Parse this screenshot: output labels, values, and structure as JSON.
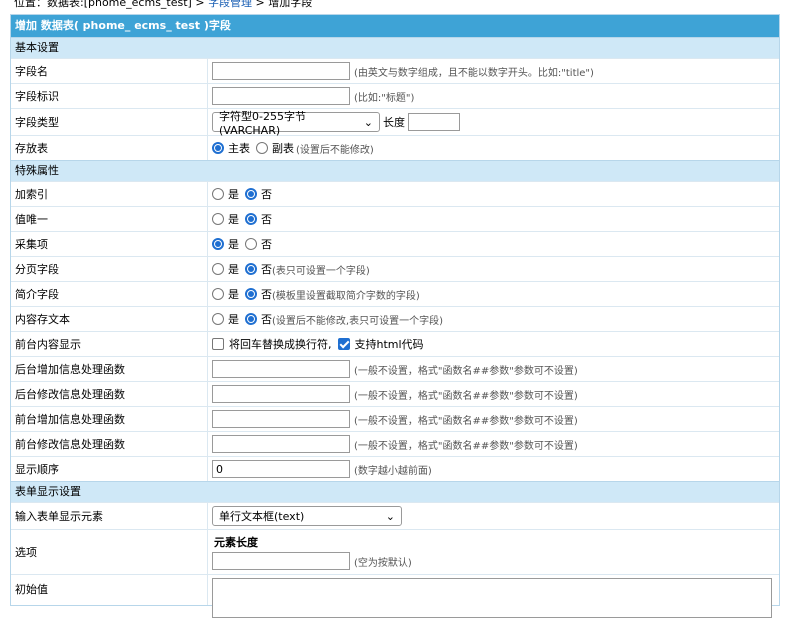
{
  "breadcrumb": {
    "prefix": "位置：",
    "table_text": "数据表:[phome_ecms_test]",
    "sep1": " > ",
    "link": "字段管理",
    "sep2": " > ",
    "current": "增加字段"
  },
  "panel_title": "增加 数据表( phome_ ecms_ test )字段",
  "basic": {
    "section": "基本设置",
    "field_name": {
      "label": "字段名",
      "value": "",
      "hint": "(由英文与数字组成，且不能以数字开头。比如:\"title\")"
    },
    "field_mark": {
      "label": "字段标识",
      "value": "",
      "hint": "(比如:\"标题\")"
    },
    "field_type": {
      "label": "字段类型",
      "selected": "字符型0-255字节(VARCHAR)",
      "length_label": "长度",
      "length_value": ""
    },
    "store_table": {
      "label": "存放表",
      "opt1": "主表",
      "opt2": "副表",
      "hint": "(设置后不能修改)"
    }
  },
  "special": {
    "section": "特殊属性",
    "index": {
      "label": "加索引",
      "yes": "是",
      "no": "否",
      "hint": ""
    },
    "unique": {
      "label": "值唯一",
      "yes": "是",
      "no": "否",
      "hint": ""
    },
    "collect": {
      "label": "采集项",
      "yes": "是",
      "no": "否",
      "hint": ""
    },
    "page": {
      "label": "分页字段",
      "yes": "是",
      "no": "否",
      "hint": "(表只可设置一个字段)"
    },
    "intro": {
      "label": "简介字段",
      "yes": "是",
      "no": "否",
      "hint": "(模板里设置截取简介字数的字段)"
    },
    "content_text": {
      "label": "内容存文本",
      "yes": "是",
      "no": "否",
      "hint": "(设置后不能修改,表只可设置一个字段)"
    },
    "front_display": {
      "label": "前台内容显示",
      "opt1": "将回车替换成换行符,",
      "opt2": "支持html代码"
    },
    "admin_add_func": {
      "label": "后台增加信息处理函数",
      "value": "",
      "hint": "(一般不设置，格式\"函数名##参数\"参数可不设置)"
    },
    "admin_edit_func": {
      "label": "后台修改信息处理函数",
      "value": "",
      "hint": "(一般不设置，格式\"函数名##参数\"参数可不设置)"
    },
    "front_add_func": {
      "label": "前台增加信息处理函数",
      "value": "",
      "hint": "(一般不设置，格式\"函数名##参数\"参数可不设置)"
    },
    "front_edit_func": {
      "label": "前台修改信息处理函数",
      "value": "",
      "hint": "(一般不设置，格式\"函数名##参数\"参数可不设置)"
    },
    "order": {
      "label": "显示顺序",
      "value": "0",
      "hint": "(数字越小越前面)"
    }
  },
  "form": {
    "section": "表单显示设置",
    "element": {
      "label": "输入表单显示元素",
      "selected": "单行文本框(text)"
    },
    "options": {
      "label": "选项",
      "sub_label": "元素长度",
      "value": "",
      "hint": "(空为按默认)"
    },
    "initial": {
      "label": "初始值"
    }
  },
  "colors": {
    "title_bg": "#3ea3d6",
    "section_bg": "#cfe8f7",
    "accent": "#1f6fd1",
    "link": "#1a5fb4"
  }
}
